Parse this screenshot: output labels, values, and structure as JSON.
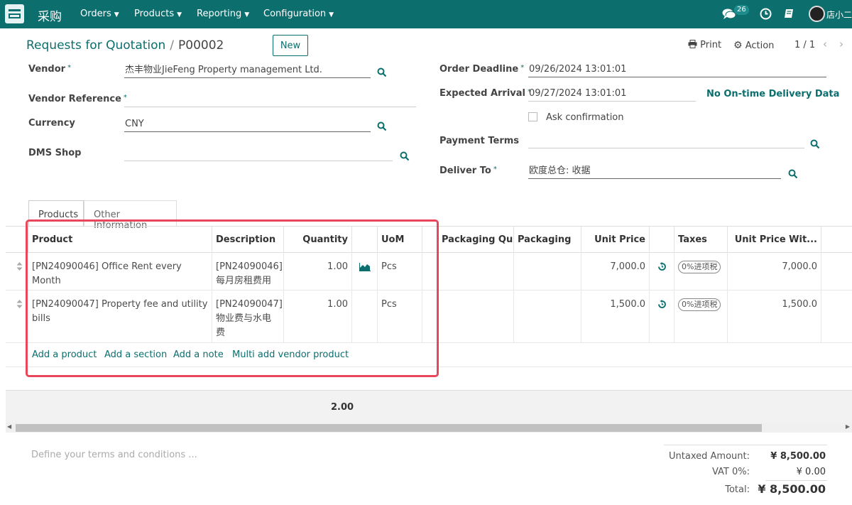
{
  "navbar": {
    "app_name": "采购",
    "menus": [
      "Orders",
      "Products",
      "Reporting",
      "Configuration"
    ],
    "chat_count": "26",
    "user_name": "店小二"
  },
  "control_panel": {
    "breadcrumb_parent": "Requests for Quotation",
    "breadcrumb_current": "P00002",
    "new_label": "New",
    "print_label": "Print",
    "action_label": "Action",
    "pager": "1 / 1"
  },
  "form": {
    "vendor_label": "Vendor",
    "vendor_value": "杰丰物业JieFeng Property management Ltd.",
    "vendor_ref_label": "Vendor Reference",
    "vendor_ref_value": "",
    "currency_label": "Currency",
    "currency_value": "CNY",
    "dms_label": "DMS Shop",
    "dms_value": "",
    "deadline_label": "Order Deadline",
    "deadline_value": "09/26/2024 13:01:01",
    "arrival_label": "Expected Arrival",
    "arrival_value": "09/27/2024 13:01:01",
    "ontime_text": "No On-time Delivery Data",
    "ask_label": "Ask confirmation",
    "payment_label": "Payment Terms",
    "payment_value": "",
    "deliver_label": "Deliver To",
    "deliver_value": "欧度总仓: 收据"
  },
  "tabs": [
    "Products",
    "Other Information"
  ],
  "table": {
    "headers": [
      "Product",
      "Description",
      "Quantity",
      "UoM",
      "Packaging Qu...",
      "Packaging",
      "Unit Price",
      "Taxes",
      "Unit Price Wit..."
    ],
    "rows": [
      {
        "product": "[PN24090046] Office Rent every Month",
        "desc1": "[PN24090046]",
        "desc2": "每月房租费用",
        "desc3": "",
        "qty": "1.00",
        "uom": "Pcs",
        "unit_price": "7,000.0",
        "tax": "0%进项税",
        "unit_price_with": "7,000.0"
      },
      {
        "product": "[PN24090047] Property fee and utility bills",
        "desc1": "[PN24090047]",
        "desc2": "物业费与水电",
        "desc3": "费",
        "qty": "1.00",
        "uom": "Pcs",
        "unit_price": "1,500.0",
        "tax": "0%进项税",
        "unit_price_with": "1,500.0"
      }
    ],
    "add_links": [
      "Add a product",
      "Add a section",
      "Add a note",
      "Multi add vendor product"
    ],
    "total_qty": "2.00"
  },
  "terms_placeholder": "Define your terms and conditions ...",
  "totals": {
    "untaxed_label": "Untaxed Amount:",
    "untaxed_value": "¥ 8,500.00",
    "vat_label": "VAT 0%:",
    "vat_value": "¥ 0.00",
    "total_label": "Total:",
    "total_value": "¥ 8,500.00"
  },
  "colors": {
    "brand": "#0d6e6e",
    "highlight": "#e8465b"
  }
}
